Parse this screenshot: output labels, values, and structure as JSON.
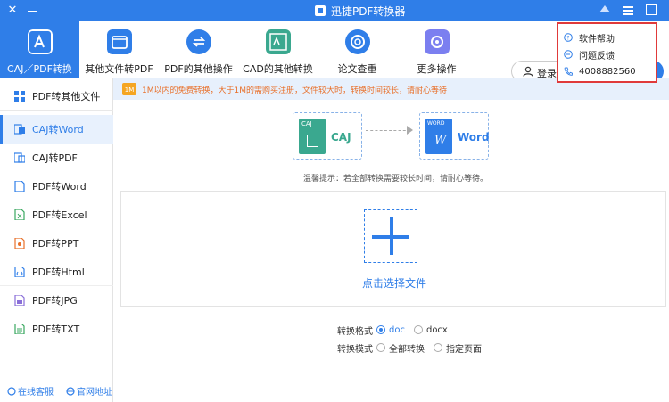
{
  "window": {
    "title": "迅捷PDF转换器",
    "close_glyph": "✕"
  },
  "toolbar": {
    "tools": [
      {
        "label": "CAJ／PDF转换",
        "icon": "caj-pdf-convert-icon",
        "active": true
      },
      {
        "label": "其他文件转PDF",
        "icon": "folder-icon"
      },
      {
        "label": "PDF的其他操作",
        "icon": "sync-icon"
      },
      {
        "label": "CAD的其他转换",
        "icon": "cad-icon"
      },
      {
        "label": "论文查重",
        "icon": "at-search-icon"
      },
      {
        "label": "更多操作",
        "icon": "gear-icon"
      }
    ],
    "login_label": "登录/"
  },
  "sidebar": {
    "header": "PDF转其他文件",
    "items": [
      {
        "label": "CAJ转Word",
        "icon": "caj-word-icon"
      },
      {
        "label": "CAJ转PDF",
        "icon": "caj-pdf-icon"
      },
      {
        "label": "PDF转Word",
        "icon": "pdf-word-icon"
      },
      {
        "label": "PDF转Excel",
        "icon": "pdf-excel-icon"
      },
      {
        "label": "PDF转PPT",
        "icon": "pdf-ppt-icon"
      },
      {
        "label": "PDF转Html",
        "icon": "pdf-html-icon"
      },
      {
        "label": "PDF转JPG",
        "icon": "pdf-jpg-icon"
      },
      {
        "label": "PDF转TXT",
        "icon": "pdf-txt-icon"
      }
    ],
    "footer": {
      "service": "在线客服",
      "website": "官网地址"
    }
  },
  "notice": {
    "badge": "1M",
    "text": "1M以内的免费转换，大于1M的需购买注册，文件较大时，转换时间较长，请耐心等待"
  },
  "conversion": {
    "source": {
      "tag": "CAJ",
      "label": "CAJ"
    },
    "target": {
      "tag": "WORD",
      "letter": "W",
      "label": "Word"
    },
    "tip": "温馨提示：若全部转换需要较长时间，请耐心等待。"
  },
  "dropzone": {
    "select_label": "点击选择文件"
  },
  "options": {
    "format": {
      "label": "转换格式",
      "choices": [
        "doc",
        "docx"
      ],
      "selected": "doc"
    },
    "mode": {
      "label": "转换模式",
      "choices": [
        "全部转换",
        "指定页面"
      ],
      "selected": null
    }
  },
  "popup_menu": {
    "items": [
      {
        "label": "软件帮助",
        "icon": "help-icon"
      },
      {
        "label": "问题反馈",
        "icon": "feedback-icon"
      },
      {
        "label": "4008882560",
        "icon": "phone-icon"
      }
    ]
  },
  "colors": {
    "accent": "#2f7ee8",
    "notice_text": "#e8702a",
    "caj_green": "#3aa88f",
    "word_blue": "#2f7ee8",
    "highlight_border": "#e03a3a"
  }
}
